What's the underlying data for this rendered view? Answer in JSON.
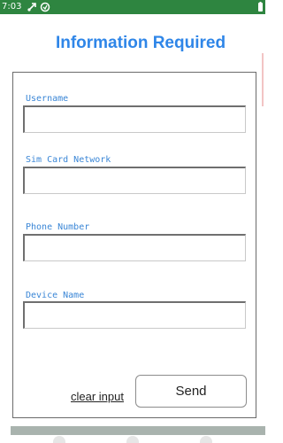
{
  "status_bar": {
    "time": "7:03",
    "icons": [
      "usb-debug-icon",
      "sync-icon"
    ],
    "right_icons": [
      "battery-icon"
    ],
    "color": "#2e8540"
  },
  "form": {
    "title": "Information Required",
    "fields": [
      {
        "label": "Username",
        "value": "",
        "placeholder": ""
      },
      {
        "label": "Sim Card Network",
        "value": "",
        "placeholder": ""
      },
      {
        "label": "Phone Number",
        "value": "",
        "placeholder": ""
      },
      {
        "label": "Device Name",
        "value": "",
        "placeholder": ""
      }
    ],
    "clear_label": "clear input",
    "send_label": "Send"
  },
  "colors": {
    "title": "#2f86e8",
    "label": "#3a86d6"
  }
}
